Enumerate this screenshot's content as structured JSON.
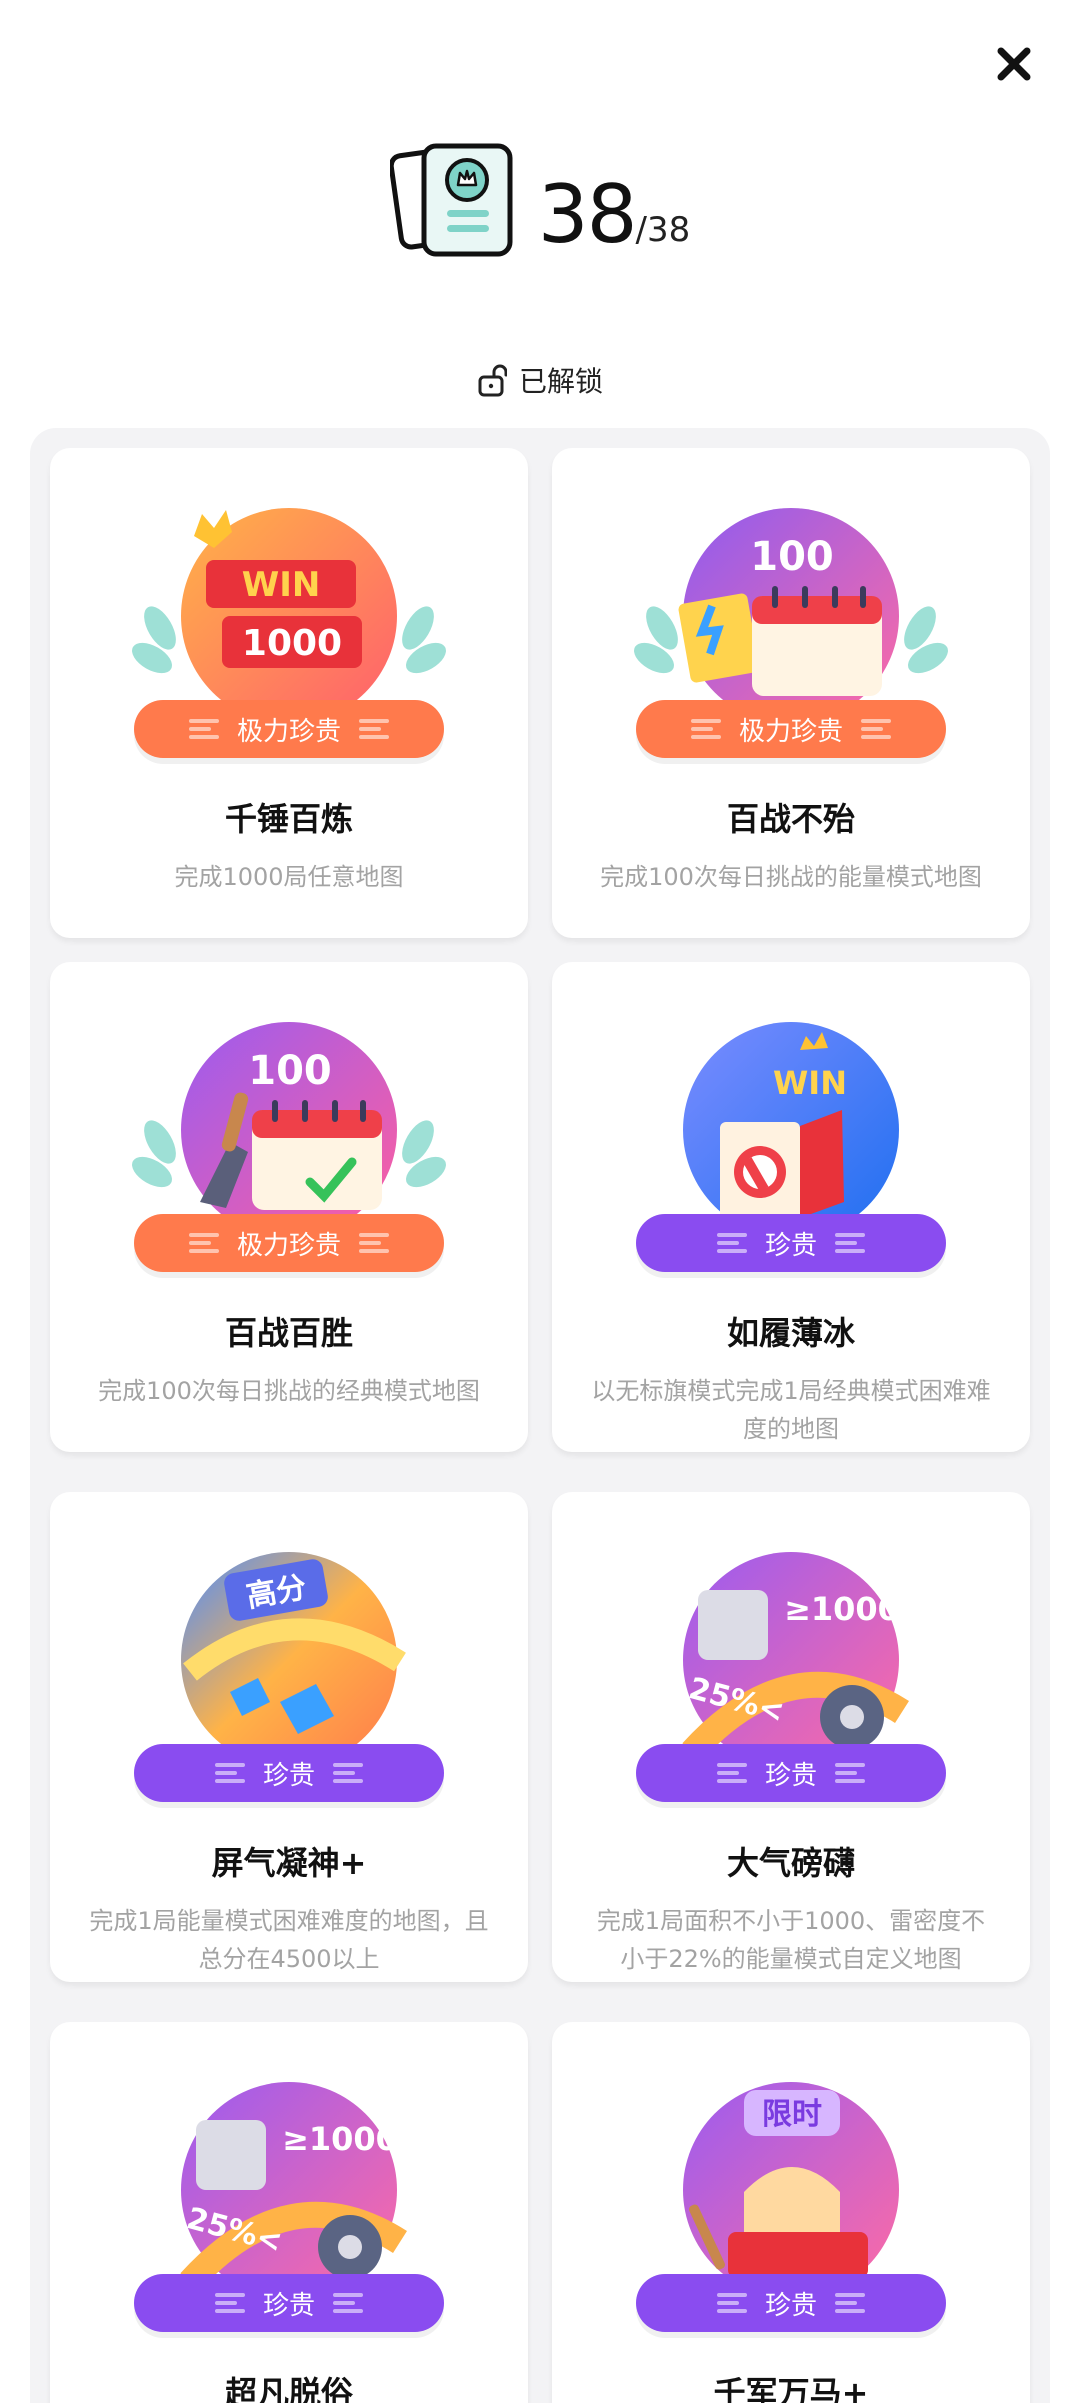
{
  "header": {
    "count": "38",
    "total": "/38"
  },
  "status": {
    "label": "已解锁"
  },
  "cards": [
    {
      "art": "win-1000-badge",
      "rarity": "极力珍贵",
      "rarity_level": "very-precious",
      "title": "千锤百炼",
      "desc": "完成1000局任意地图"
    },
    {
      "art": "calendar-100-energy-badge",
      "rarity": "极力珍贵",
      "rarity_level": "very-precious",
      "title": "百战不殆",
      "desc": "完成100次每日挑战的能量模式地图"
    },
    {
      "art": "calendar-100-classic-badge",
      "rarity": "极力珍贵",
      "rarity_level": "very-precious",
      "title": "百战百胜",
      "desc": "完成100次每日挑战的经典模式地图"
    },
    {
      "art": "no-flag-win-badge",
      "rarity": "珍贵",
      "rarity_level": "precious",
      "title": "如履薄冰",
      "desc": "以无标旗模式完成1局经典模式困难难度的地图"
    },
    {
      "art": "high-score-badge",
      "rarity": "珍贵",
      "rarity_level": "precious",
      "title": "屏气凝神+",
      "desc": "完成1局能量模式困难难度的地图，且总分在4500以上"
    },
    {
      "art": "mine-density-badge",
      "rarity": "珍贵",
      "rarity_level": "precious",
      "title": "大气磅礴",
      "desc": "完成1局面积不小于1000、雷密度不小于22%的能量模式自定义地图"
    },
    {
      "art": "mine-density-badge-2",
      "rarity": "珍贵",
      "rarity_level": "precious",
      "title": "超凡脱俗",
      "desc": ""
    },
    {
      "art": "limited-time-badge",
      "rarity": "珍贵",
      "rarity_level": "precious",
      "title": "千军万马+",
      "desc": ""
    }
  ],
  "badge_text": {
    "win": "WIN",
    "thousand": "1000",
    "hundred": "100",
    "high_score": "高分",
    "ge_1000": "≥1000",
    "pct_25": "25%<",
    "limited": "限时"
  },
  "colors": {
    "precious": "#8a4cf0",
    "very_precious": "#ff7a4c",
    "panel": "#f3f3f5",
    "desc": "#a3a3a3"
  }
}
